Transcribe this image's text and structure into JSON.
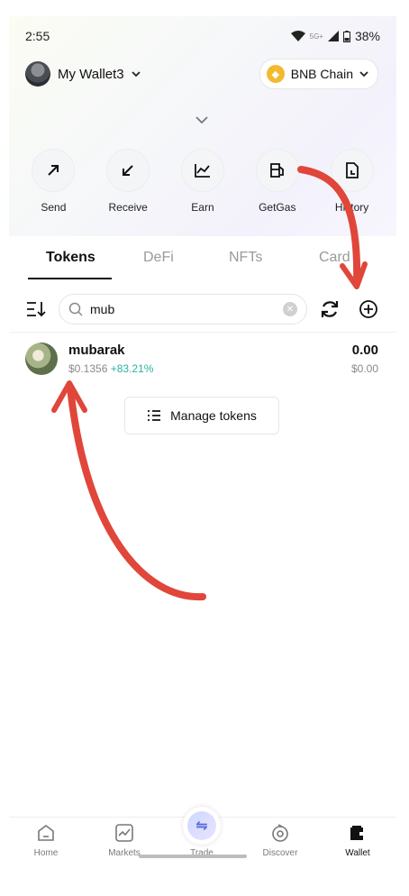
{
  "status": {
    "time": "2:55",
    "network": "5G+",
    "battery": "38%"
  },
  "wallet": {
    "name": "My Wallet3",
    "chain": "BNB Chain"
  },
  "actions": [
    {
      "label": "Send",
      "icon": "send-arrow-icon"
    },
    {
      "label": "Receive",
      "icon": "receive-arrow-icon"
    },
    {
      "label": "Earn",
      "icon": "chart-icon"
    },
    {
      "label": "GetGas",
      "icon": "gas-pump-icon"
    },
    {
      "label": "History",
      "icon": "document-icon"
    }
  ],
  "tabs": [
    "Tokens",
    "DeFi",
    "NFTs",
    "Card"
  ],
  "search": {
    "value": "mub"
  },
  "token": {
    "name": "mubarak",
    "price": "$0.1356",
    "change": "+83.21%",
    "amount": "0.00",
    "value": "$0.00"
  },
  "manage_label": "Manage tokens",
  "nav": [
    {
      "label": "Home"
    },
    {
      "label": "Markets"
    },
    {
      "label": "Trade"
    },
    {
      "label": "Discover"
    },
    {
      "label": "Wallet"
    }
  ],
  "colors": {
    "accent_positive": "#2cb39f",
    "chain_bnb": "#f3ba2f",
    "annotation": "#e0463a"
  }
}
